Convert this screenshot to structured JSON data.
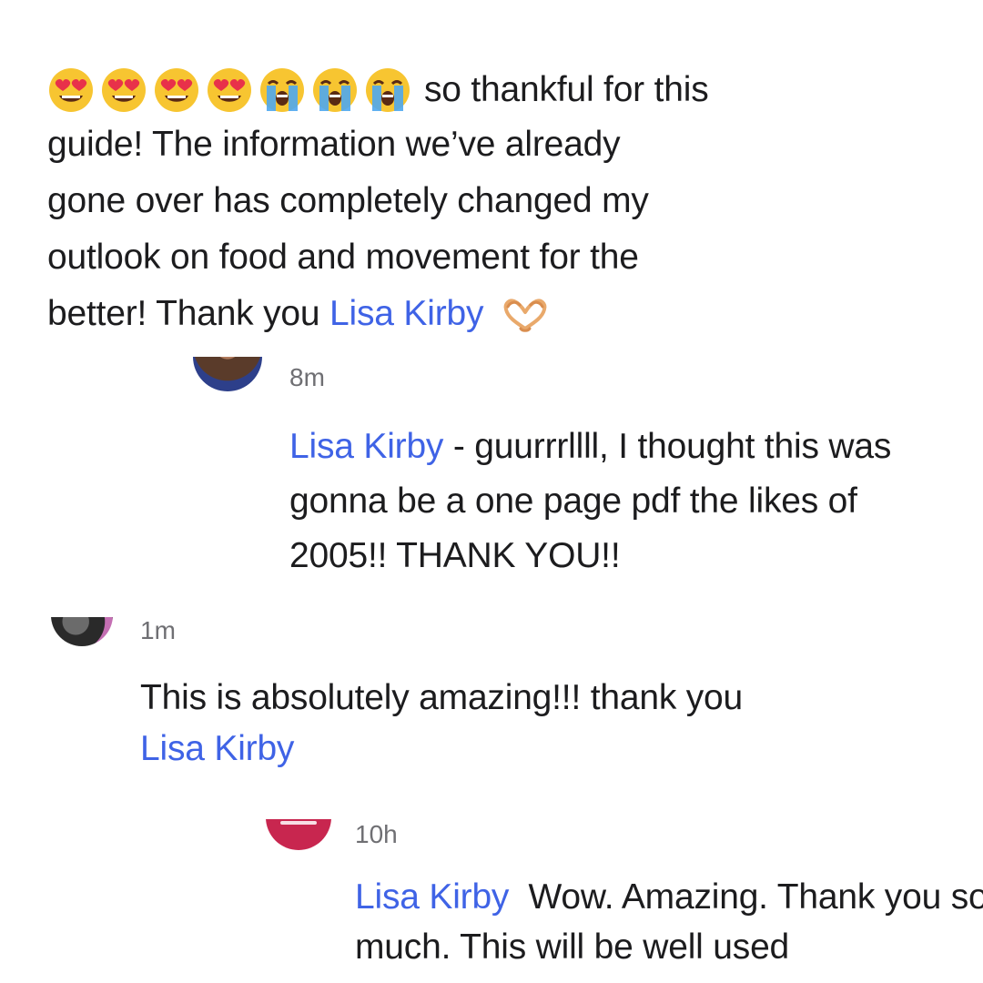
{
  "post": {
    "emojis": [
      "heart-eyes",
      "heart-eyes",
      "heart-eyes",
      "heart-eyes",
      "loudly-crying",
      "loudly-crying",
      "loudly-crying"
    ],
    "line1_text": "so thankful for this",
    "line2": "guide! The information we’ve already",
    "line3": "gone over has completely changed my",
    "line4": "outlook on food and movement for the",
    "line5_text": "better! Thank you ",
    "line5_mention": "Lisa Kirby",
    "trailing_emoji": "heart-hands"
  },
  "comments": [
    {
      "timestamp": "8m",
      "mention": "Lisa Kirby",
      "line1_text": " - guurrrllll, I thought this was",
      "line2": "gonna be a one page pdf the likes of",
      "line3": "2005!! THANK YOU!!"
    },
    {
      "timestamp": "1m",
      "line1": "This is absolutely amazing!!! thank you",
      "mention": "Lisa Kirby"
    },
    {
      "timestamp": "10h",
      "mention": "Lisa Kirby",
      "line1_text": "  Wow. Amazing. Thank you so",
      "line2": "much. This will be well used"
    }
  ],
  "colors": {
    "mention": "#3f63e6",
    "timestamp": "#6f6f73",
    "text": "#1c1c1e",
    "avatar_initials_bg": "#c8264f"
  }
}
